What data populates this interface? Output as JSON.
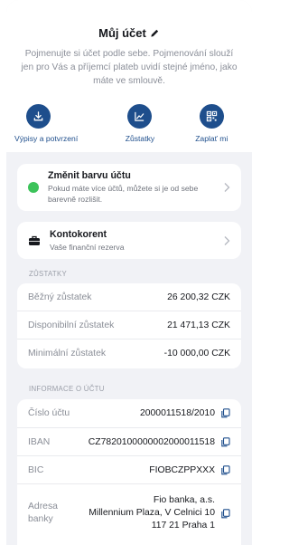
{
  "header": {
    "title": "Můj účet",
    "subtitle": "Pojmenujte si účet podle sebe. Pojmenování slouží jen pro Vás a příjemcí plateb uvidí stejné jméno, jako máte ve smlouvě."
  },
  "actions": [
    {
      "label": "Výpisy a potvrzení",
      "icon": "download-icon"
    },
    {
      "label": "Zůstatky",
      "icon": "chart-icon"
    },
    {
      "label": "Zaplať mi",
      "icon": "qr-code-icon"
    }
  ],
  "color_card": {
    "title": "Změnit barvu účtu",
    "description": "Pokud máte více účtů, můžete si je od sebe barevně rozlišit.",
    "dot_color": "#3cc35a"
  },
  "account_card": {
    "title": "Kontokorent",
    "description": "Vaše finanční rezerva"
  },
  "balances": {
    "section_title": "ZŮSTATKY",
    "rows": [
      {
        "label": "Běžný zůstatek",
        "value": "26 200,32 CZK"
      },
      {
        "label": "Disponibilní zůstatek",
        "value": "21 471,13 CZK"
      },
      {
        "label": "Minimální zůstatek",
        "value": "-10 000,00 CZK"
      }
    ]
  },
  "account_info": {
    "section_title": "INFORMACE O ÚČTU",
    "account_number_label": "Číslo účtu",
    "account_number": "2000011518/2010",
    "iban_label": "IBAN",
    "iban": "CZ7820100000002000011518",
    "bic_label": "BIC",
    "bic": "FIOBCZPPXXX",
    "address_label_1": "Adresa",
    "address_label_2": "banky",
    "address_line_1": "Fio banka, a.s.",
    "address_line_2": "Millennium Plaza, V Celnici 10",
    "address_line_3": "117 21 Praha 1"
  },
  "colors": {
    "accent": "#1e4e8c",
    "background": "#f1f2f6"
  }
}
